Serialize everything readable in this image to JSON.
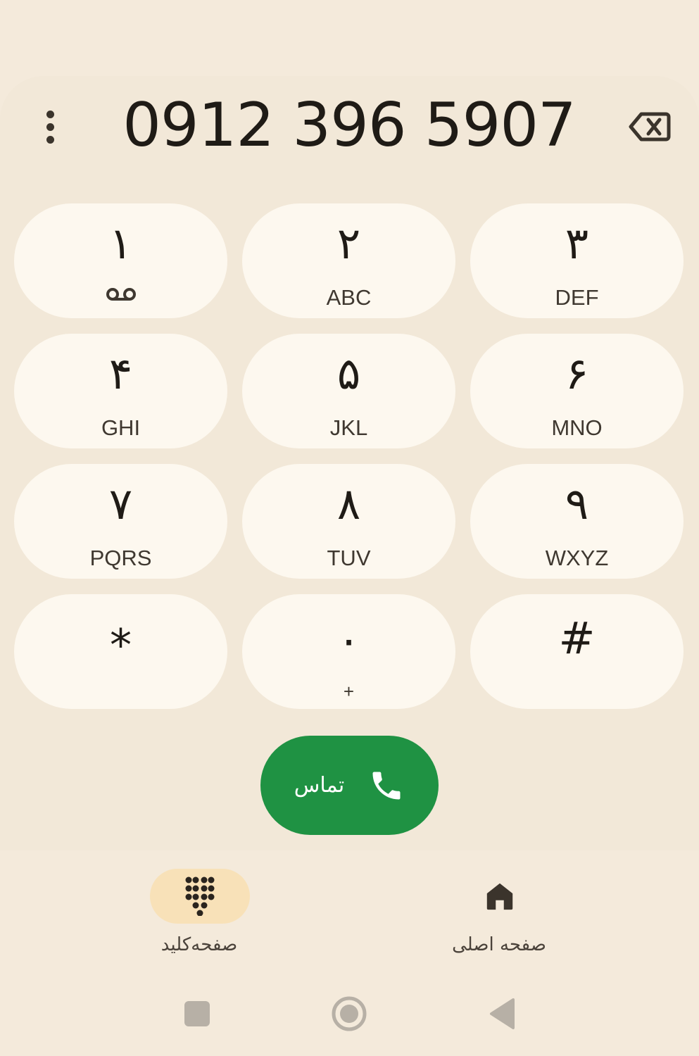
{
  "dialer": {
    "number": "0912 396 5907"
  },
  "keypad": [
    {
      "digit": "۱",
      "letters": "",
      "voicemail": true
    },
    {
      "digit": "۲",
      "letters": "ABC"
    },
    {
      "digit": "۳",
      "letters": "DEF"
    },
    {
      "digit": "۴",
      "letters": "GHI"
    },
    {
      "digit": "۵",
      "letters": "JKL"
    },
    {
      "digit": "۶",
      "letters": "MNO"
    },
    {
      "digit": "۷",
      "letters": "PQRS"
    },
    {
      "digit": "۸",
      "letters": "TUV"
    },
    {
      "digit": "۹",
      "letters": "WXYZ"
    },
    {
      "digit": "*",
      "letters": ""
    },
    {
      "digit": "۰",
      "letters": "+"
    },
    {
      "digit": "#",
      "letters": ""
    }
  ],
  "call": {
    "label": "تماس"
  },
  "bottom_nav": {
    "keypad_label": "صفحه‌کلید",
    "home_label": "صفحه اصلی"
  },
  "colors": {
    "background": "#f4eadb",
    "key": "#fdf8ef",
    "call": "#1f9243",
    "active_pill": "#f8e1b8"
  }
}
